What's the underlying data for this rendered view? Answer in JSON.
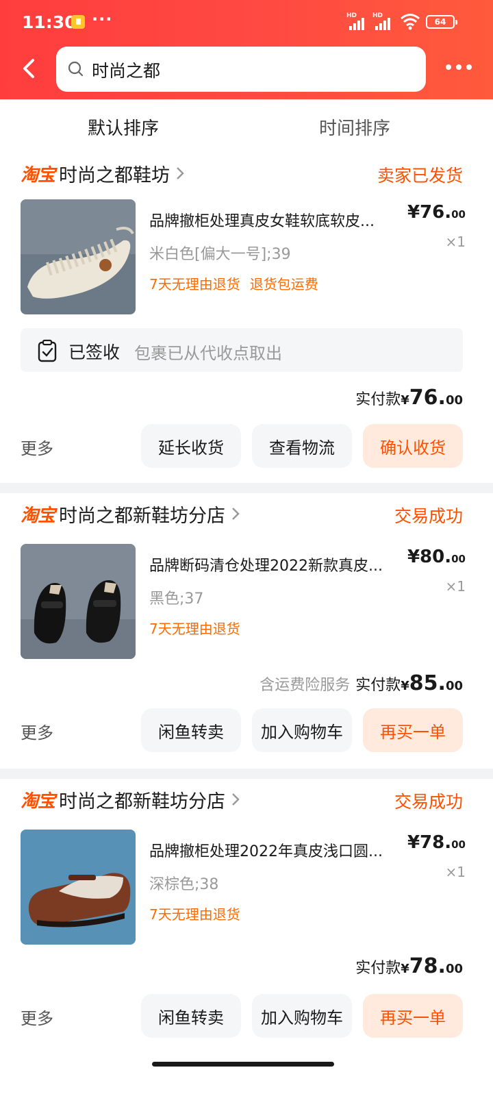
{
  "status_bar": {
    "time": "11:30",
    "notif_dots": "···",
    "battery": "64",
    "hd1": "HD",
    "hd2": "HD"
  },
  "search": {
    "query": "时尚之都"
  },
  "sort_tabs": [
    {
      "label": "默认排序"
    },
    {
      "label": "时间排序"
    }
  ],
  "orders": [
    {
      "platform": "淘宝",
      "shop": "时尚之都鞋坊",
      "status": "卖家已发货",
      "title": "品牌撤柜处理真皮女鞋软底软皮...",
      "price_int": "¥76.",
      "price_dec": "00",
      "qty": "×1",
      "spec": "米白色[偏大一号];39",
      "promos": [
        "7天无理由退货",
        "退货包运费"
      ],
      "logistics_title": "已签收",
      "logistics_desc": "包裹已从代收点取出",
      "paid_label": "实付款",
      "paid_yen": "¥",
      "paid_int": "76.",
      "paid_dec": "00",
      "more": "更多",
      "buttons": [
        "延长收货",
        "查看物流",
        "确认收货"
      ]
    },
    {
      "platform": "淘宝",
      "shop": "时尚之都新鞋坊分店",
      "status": "交易成功",
      "title": "品牌断码清仓处理2022新款真皮...",
      "price_int": "¥80.",
      "price_dec": "00",
      "qty": "×1",
      "spec": "黑色;37",
      "promos": [
        "7天无理由退货"
      ],
      "paid_note": "含运费险服务",
      "paid_label": "实付款",
      "paid_yen": "¥",
      "paid_int": "85.",
      "paid_dec": "00",
      "more": "更多",
      "buttons": [
        "闲鱼转卖",
        "加入购物车",
        "再买一单"
      ]
    },
    {
      "platform": "淘宝",
      "shop": "时尚之都新鞋坊分店",
      "status": "交易成功",
      "title": "品牌撤柜处理2022年真皮浅口圆...",
      "price_int": "¥78.",
      "price_dec": "00",
      "qty": "×1",
      "spec": "深棕色;38",
      "promos": [
        "7天无理由退货"
      ],
      "paid_label": "实付款",
      "paid_yen": "¥",
      "paid_int": "78.",
      "paid_dec": "00",
      "more": "更多",
      "buttons": [
        "闲鱼转卖",
        "加入购物车",
        "再买一单"
      ]
    }
  ],
  "colors": {
    "brand": "#ff5000",
    "header": "#ff4040",
    "primary_btn_bg": "#ffeadd"
  }
}
